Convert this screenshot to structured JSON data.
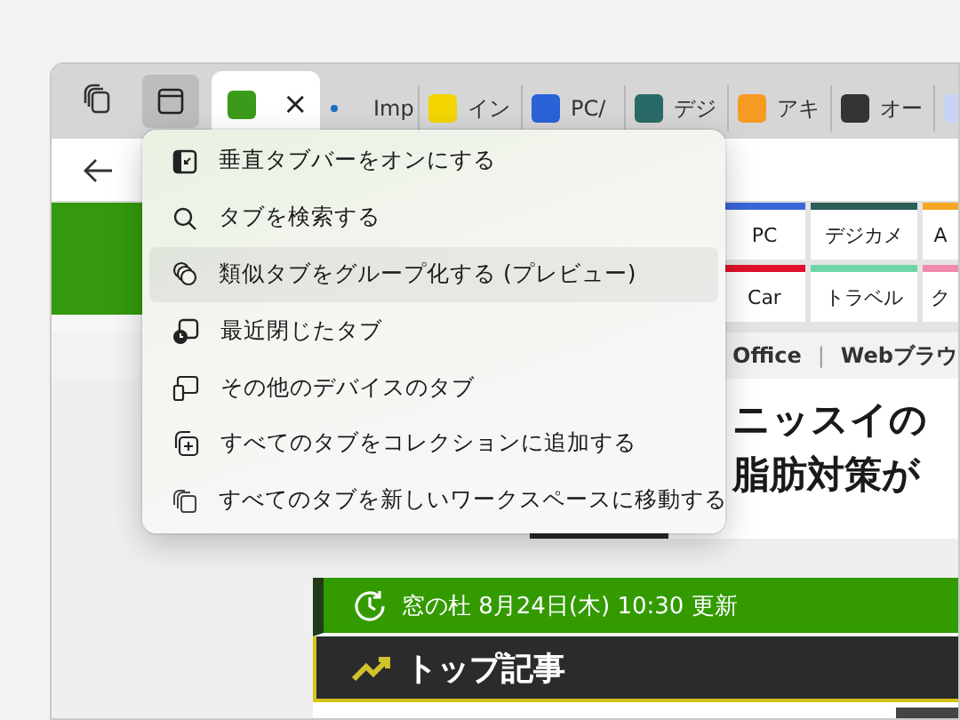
{
  "tab_strip": {
    "vertical_tabs_button": {
      "pressed": true
    },
    "tabs": [
      {
        "kind": "favicon",
        "color": "#3a9a1a",
        "selected": true,
        "close": "×"
      },
      {
        "kind": "dot",
        "color": "#1a6fc4",
        "selected": false,
        "label": "Imp"
      },
      {
        "kind": "favicon",
        "color": "#f2d500",
        "selected": false,
        "label": "イン"
      },
      {
        "kind": "favicon",
        "color": "#2a62d8",
        "selected": false,
        "label": "PC/"
      },
      {
        "kind": "favicon",
        "color": "#2a6a66",
        "selected": false,
        "label": "デジ"
      },
      {
        "kind": "favicon",
        "color": "#f59a22",
        "selected": false,
        "label": "アキ"
      },
      {
        "kind": "favicon",
        "color": "#333333",
        "selected": false,
        "label": "オー"
      },
      {
        "kind": "favicon",
        "color": "#c8d4f4",
        "selected": false
      }
    ]
  },
  "tab_actions_menu": [
    {
      "label": "垂直タブバーをオンにする",
      "selected": false
    },
    {
      "label": "タブを検索する",
      "selected": false
    },
    {
      "label": "類似タブをグループ化する (プレビュー)",
      "selected": true
    },
    {
      "label": "最近閉じたタブ",
      "selected": false
    },
    {
      "label": "その他のデバイスのタブ",
      "selected": false
    },
    {
      "label": "すべてのタブをコレクションに追加する",
      "selected": false
    },
    {
      "label": "すべてのタブを新しいワークスペースに移動する",
      "selected": false
    }
  ],
  "page": {
    "categories": [
      {
        "label": "PC",
        "color": "#3a66d8"
      },
      {
        "label": "デジカメ",
        "color": "#2c5e58"
      },
      {
        "label": "A",
        "color": "#f5a623"
      },
      {
        "label": "Car",
        "color": "#e0102a"
      },
      {
        "label": "トラベル",
        "color": "#6fd6a8"
      },
      {
        "label": "ク",
        "color": "#f28ab0"
      }
    ],
    "links": [
      "Office",
      "|",
      "Webブラウ"
    ],
    "headline": [
      "ニッスイの",
      "脂肪対策が"
    ],
    "update_bar": "窓の杜 8月24日(木) 10:30 更新",
    "section_title": "トップ記事"
  }
}
